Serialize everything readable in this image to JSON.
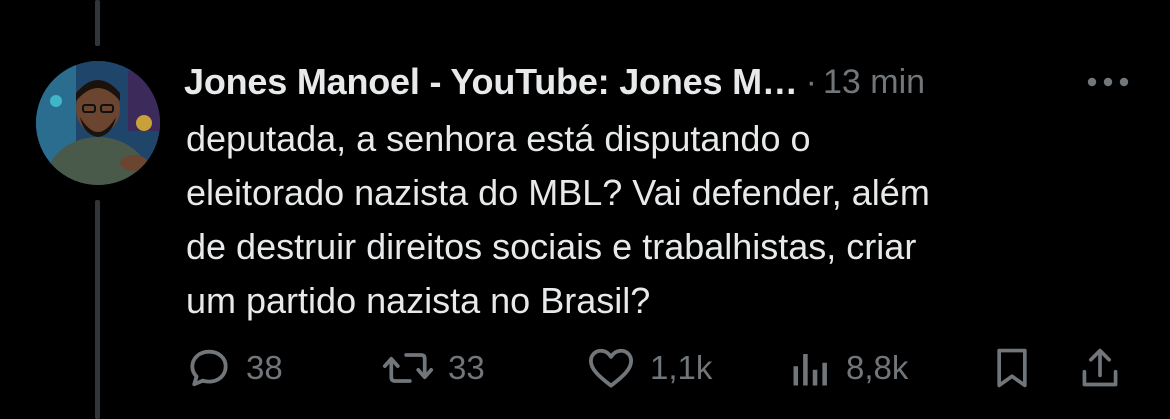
{
  "post": {
    "author": {
      "display_name": "Jones Manoel - YouTube: Jones M…",
      "avatar_icon": "profile-photo"
    },
    "separator": "·",
    "timestamp": "13 min",
    "text_lines": [
      "deputada, a senhora está disputando o",
      "eleitorado nazista do MBL? Vai defender, além",
      "de destruir direitos sociais e trabalhistas, criar",
      "um partido nazista no Brasil?"
    ]
  },
  "actions": {
    "reply": {
      "icon": "comment-icon",
      "count": "38"
    },
    "repost": {
      "icon": "repost-icon",
      "count": "33"
    },
    "like": {
      "icon": "heart-icon",
      "count": "1,1k"
    },
    "views": {
      "icon": "views-icon",
      "count": "8,8k"
    },
    "bookmark": {
      "icon": "bookmark-icon"
    },
    "share": {
      "icon": "share-icon"
    }
  },
  "colors": {
    "background": "#000000",
    "text_primary": "#e7e9ea",
    "text_secondary": "#71767b",
    "thread_line": "#333639"
  }
}
